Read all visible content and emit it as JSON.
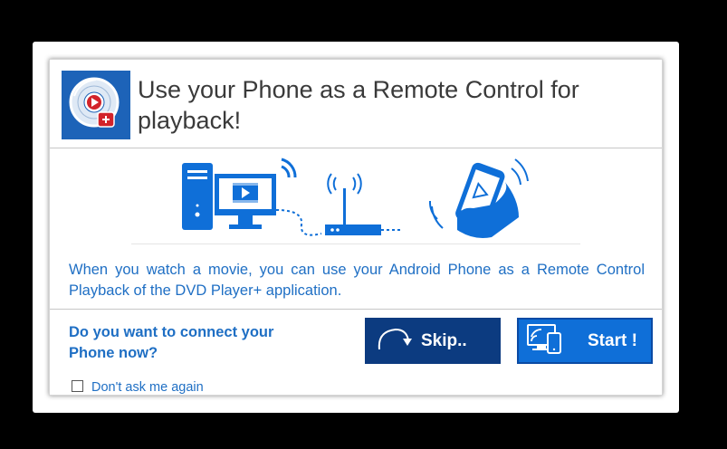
{
  "dialog": {
    "title": "Use your Phone as a Remote Control for playback!",
    "description": "When you watch a movie, you can use your Android Phone as a Remote Control Playback of the DVD Player+ application.",
    "question": "Do you want to connect your Phone now?",
    "skip_label": "Skip..",
    "start_label": "Start !",
    "dont_ask_label": "Don't ask me again",
    "dont_ask_checked": false
  },
  "icons": {
    "app": "dvd-player-app-icon",
    "illustration": [
      "desktop-computer-icon",
      "monitor-play-icon",
      "router-icon",
      "phone-remote-icon"
    ],
    "skip": "curved-arrow-icon",
    "start": "monitor-phone-icon"
  },
  "colors": {
    "background": "#000000",
    "text_blue": "#1f6fc4",
    "skip_button": "#0c3b80",
    "start_button": "#0f6fd8",
    "icon_blue": "#1d63b8",
    "badge_red": "#d2232a"
  }
}
